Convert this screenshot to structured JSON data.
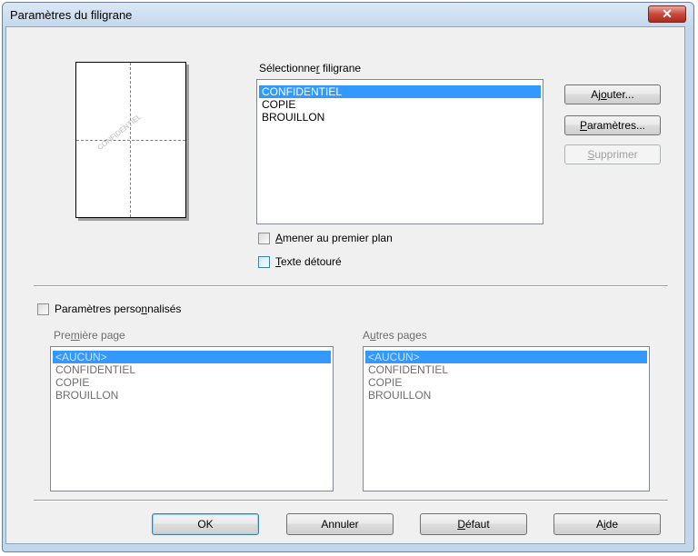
{
  "window": {
    "title": "Paramètres du filigrane",
    "close_glyph": "✕"
  },
  "preview": {
    "watermark_text": "CONFIDENTIEL"
  },
  "select_watermark": {
    "label_pre": "Sélectionne",
    "label_key": "r",
    "label_post": " filigrane",
    "items": [
      "CONFIDENTIEL",
      "COPIE",
      "BROUILLON"
    ],
    "selected": "CONFIDENTIEL"
  },
  "buttons": {
    "add": {
      "pre": "Aj",
      "key": "o",
      "post": "uter..."
    },
    "settings": {
      "pre": "",
      "key": "P",
      "post": "aramètres..."
    },
    "delete": {
      "pre": "",
      "key": "S",
      "post": "upprimer"
    }
  },
  "options": {
    "foreground": {
      "pre": "",
      "key": "A",
      "post": "mener au premier plan",
      "checked": false
    },
    "outline": {
      "pre": "",
      "key": "T",
      "post": "exte détouré",
      "checked": false
    }
  },
  "custom": {
    "pre": "Paramètres perso",
    "key": "n",
    "post": "nalisés",
    "checked": false,
    "first_page": {
      "pre": "Pre",
      "key": "m",
      "post": "ière page",
      "items": [
        "<AUCUN>",
        "CONFIDENTIEL",
        "COPIE",
        "BROUILLON"
      ],
      "selected": "<AUCUN>"
    },
    "other_pages": {
      "pre": "A",
      "key": "u",
      "post": "tres pages",
      "items": [
        "<AUCUN>",
        "CONFIDENTIEL",
        "COPIE",
        "BROUILLON"
      ],
      "selected": "<AUCUN>"
    }
  },
  "footer": {
    "ok": "OK",
    "cancel": "Annuler",
    "default": {
      "pre": "",
      "key": "D",
      "post": "éfaut"
    },
    "help": {
      "pre": "A",
      "key": "i",
      "post": "de"
    }
  },
  "colors": {
    "selection": "#3399ff",
    "title_bar": "#c2d6ec",
    "close_button": "#c9493a"
  }
}
